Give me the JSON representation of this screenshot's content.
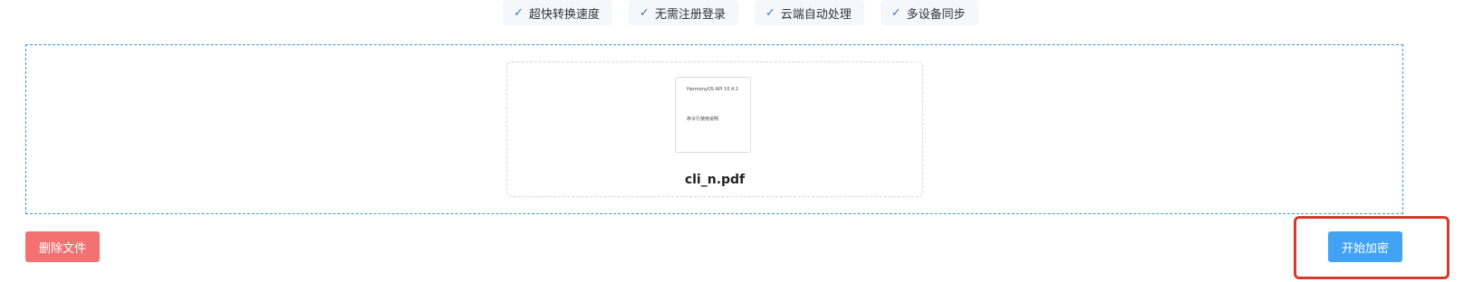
{
  "features": [
    {
      "check": "✓",
      "label": "超快转换速度"
    },
    {
      "check": "✓",
      "label": "无需注册登录"
    },
    {
      "check": "✓",
      "label": "云端自动处理"
    },
    {
      "check": "✓",
      "label": "多设备同步"
    }
  ],
  "file": {
    "name": "cli_n.pdf",
    "thumbnail_lines": [
      "HarmonyOS API 10.4.2",
      "命令行使用说明"
    ]
  },
  "buttons": {
    "delete_label": "删除文件",
    "encrypt_label": "开始加密"
  },
  "colors": {
    "dropzone_border": "#3f95dd",
    "delete_button": "#f47173",
    "encrypt_button": "#42a3f5",
    "highlight_box": "#d9392b",
    "check_mark": "#3a78d6"
  }
}
